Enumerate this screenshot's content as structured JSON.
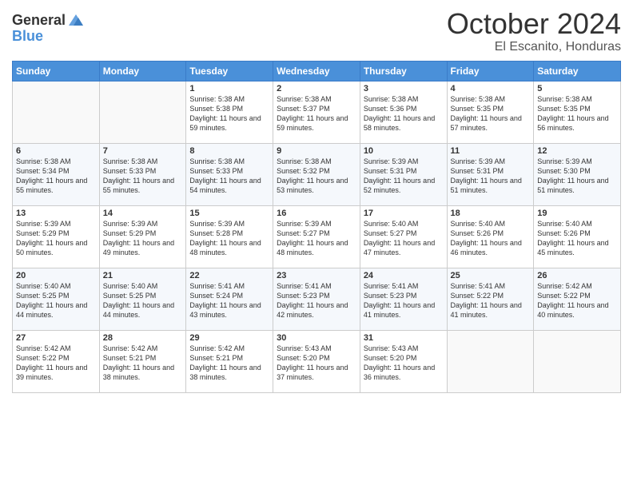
{
  "header": {
    "logo_general": "General",
    "logo_blue": "Blue",
    "month": "October 2024",
    "location": "El Escanito, Honduras"
  },
  "days_of_week": [
    "Sunday",
    "Monday",
    "Tuesday",
    "Wednesday",
    "Thursday",
    "Friday",
    "Saturday"
  ],
  "weeks": [
    [
      {
        "day": "",
        "info": ""
      },
      {
        "day": "",
        "info": ""
      },
      {
        "day": "1",
        "info": "Sunrise: 5:38 AM\nSunset: 5:38 PM\nDaylight: 11 hours and 59 minutes."
      },
      {
        "day": "2",
        "info": "Sunrise: 5:38 AM\nSunset: 5:37 PM\nDaylight: 11 hours and 59 minutes."
      },
      {
        "day": "3",
        "info": "Sunrise: 5:38 AM\nSunset: 5:36 PM\nDaylight: 11 hours and 58 minutes."
      },
      {
        "day": "4",
        "info": "Sunrise: 5:38 AM\nSunset: 5:35 PM\nDaylight: 11 hours and 57 minutes."
      },
      {
        "day": "5",
        "info": "Sunrise: 5:38 AM\nSunset: 5:35 PM\nDaylight: 11 hours and 56 minutes."
      }
    ],
    [
      {
        "day": "6",
        "info": "Sunrise: 5:38 AM\nSunset: 5:34 PM\nDaylight: 11 hours and 55 minutes."
      },
      {
        "day": "7",
        "info": "Sunrise: 5:38 AM\nSunset: 5:33 PM\nDaylight: 11 hours and 55 minutes."
      },
      {
        "day": "8",
        "info": "Sunrise: 5:38 AM\nSunset: 5:33 PM\nDaylight: 11 hours and 54 minutes."
      },
      {
        "day": "9",
        "info": "Sunrise: 5:38 AM\nSunset: 5:32 PM\nDaylight: 11 hours and 53 minutes."
      },
      {
        "day": "10",
        "info": "Sunrise: 5:39 AM\nSunset: 5:31 PM\nDaylight: 11 hours and 52 minutes."
      },
      {
        "day": "11",
        "info": "Sunrise: 5:39 AM\nSunset: 5:31 PM\nDaylight: 11 hours and 51 minutes."
      },
      {
        "day": "12",
        "info": "Sunrise: 5:39 AM\nSunset: 5:30 PM\nDaylight: 11 hours and 51 minutes."
      }
    ],
    [
      {
        "day": "13",
        "info": "Sunrise: 5:39 AM\nSunset: 5:29 PM\nDaylight: 11 hours and 50 minutes."
      },
      {
        "day": "14",
        "info": "Sunrise: 5:39 AM\nSunset: 5:29 PM\nDaylight: 11 hours and 49 minutes."
      },
      {
        "day": "15",
        "info": "Sunrise: 5:39 AM\nSunset: 5:28 PM\nDaylight: 11 hours and 48 minutes."
      },
      {
        "day": "16",
        "info": "Sunrise: 5:39 AM\nSunset: 5:27 PM\nDaylight: 11 hours and 48 minutes."
      },
      {
        "day": "17",
        "info": "Sunrise: 5:40 AM\nSunset: 5:27 PM\nDaylight: 11 hours and 47 minutes."
      },
      {
        "day": "18",
        "info": "Sunrise: 5:40 AM\nSunset: 5:26 PM\nDaylight: 11 hours and 46 minutes."
      },
      {
        "day": "19",
        "info": "Sunrise: 5:40 AM\nSunset: 5:26 PM\nDaylight: 11 hours and 45 minutes."
      }
    ],
    [
      {
        "day": "20",
        "info": "Sunrise: 5:40 AM\nSunset: 5:25 PM\nDaylight: 11 hours and 44 minutes."
      },
      {
        "day": "21",
        "info": "Sunrise: 5:40 AM\nSunset: 5:25 PM\nDaylight: 11 hours and 44 minutes."
      },
      {
        "day": "22",
        "info": "Sunrise: 5:41 AM\nSunset: 5:24 PM\nDaylight: 11 hours and 43 minutes."
      },
      {
        "day": "23",
        "info": "Sunrise: 5:41 AM\nSunset: 5:23 PM\nDaylight: 11 hours and 42 minutes."
      },
      {
        "day": "24",
        "info": "Sunrise: 5:41 AM\nSunset: 5:23 PM\nDaylight: 11 hours and 41 minutes."
      },
      {
        "day": "25",
        "info": "Sunrise: 5:41 AM\nSunset: 5:22 PM\nDaylight: 11 hours and 41 minutes."
      },
      {
        "day": "26",
        "info": "Sunrise: 5:42 AM\nSunset: 5:22 PM\nDaylight: 11 hours and 40 minutes."
      }
    ],
    [
      {
        "day": "27",
        "info": "Sunrise: 5:42 AM\nSunset: 5:22 PM\nDaylight: 11 hours and 39 minutes."
      },
      {
        "day": "28",
        "info": "Sunrise: 5:42 AM\nSunset: 5:21 PM\nDaylight: 11 hours and 38 minutes."
      },
      {
        "day": "29",
        "info": "Sunrise: 5:42 AM\nSunset: 5:21 PM\nDaylight: 11 hours and 38 minutes."
      },
      {
        "day": "30",
        "info": "Sunrise: 5:43 AM\nSunset: 5:20 PM\nDaylight: 11 hours and 37 minutes."
      },
      {
        "day": "31",
        "info": "Sunrise: 5:43 AM\nSunset: 5:20 PM\nDaylight: 11 hours and 36 minutes."
      },
      {
        "day": "",
        "info": ""
      },
      {
        "day": "",
        "info": ""
      }
    ]
  ]
}
